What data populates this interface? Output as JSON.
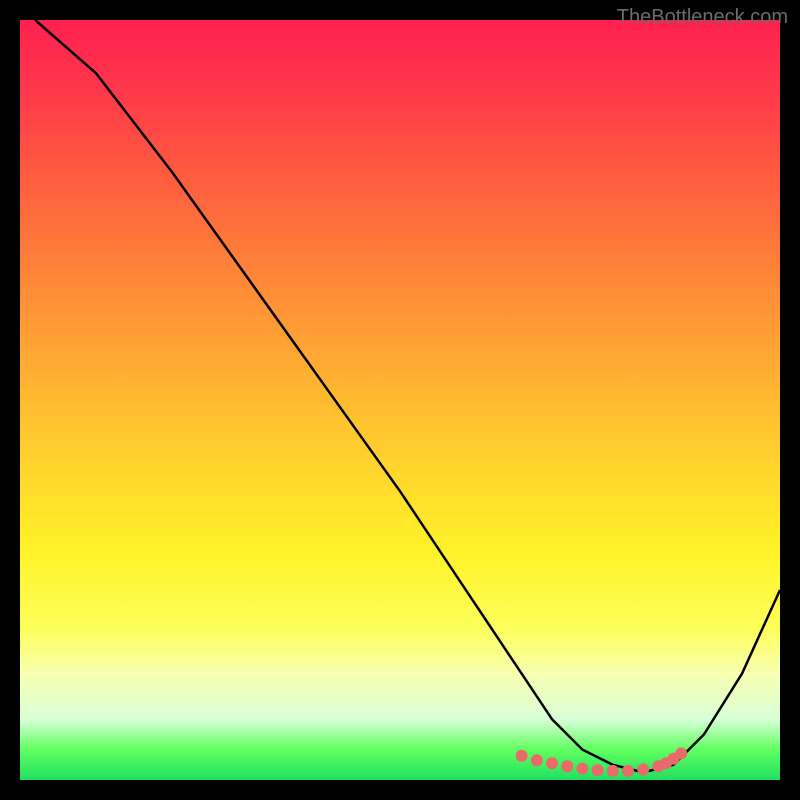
{
  "watermark": "TheBottleneck.com",
  "chart_data": {
    "type": "line",
    "title": "",
    "xlabel": "",
    "ylabel": "",
    "xlim": [
      0,
      100
    ],
    "ylim": [
      0,
      100
    ],
    "grid": false,
    "series": [
      {
        "name": "curve",
        "color": "#000000",
        "x": [
          2,
          10,
          20,
          30,
          40,
          50,
          58,
          62,
          66,
          70,
          74,
          78,
          82,
          86,
          90,
          95,
          100
        ],
        "y": [
          100,
          93,
          80,
          66,
          52,
          38,
          26,
          20,
          14,
          8,
          4,
          2,
          1,
          2,
          6,
          14,
          25
        ]
      },
      {
        "name": "highlight-dots",
        "color": "#ea6a6a",
        "x": [
          66,
          68,
          70,
          72,
          74,
          76,
          78,
          80,
          82,
          84,
          85,
          86,
          87
        ],
        "y": [
          3.2,
          2.6,
          2.2,
          1.8,
          1.5,
          1.3,
          1.2,
          1.2,
          1.4,
          1.8,
          2.2,
          2.8,
          3.5
        ]
      }
    ],
    "background_gradient": {
      "top": "#ff2050",
      "mid_upper": "#ff9a35",
      "mid": "#ffd82c",
      "mid_lower": "#fdff5a",
      "bottom": "#20e060"
    }
  }
}
